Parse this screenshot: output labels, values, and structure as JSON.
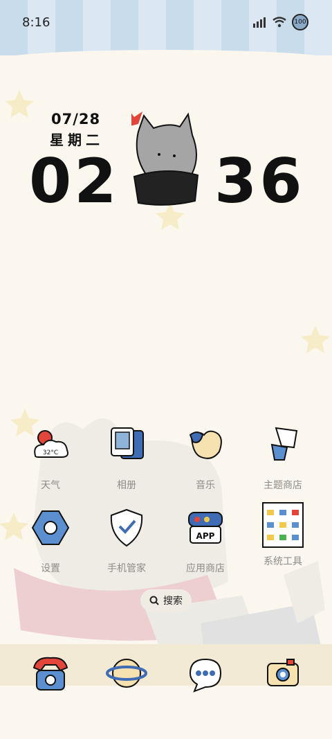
{
  "status_bar": {
    "time": "8:16",
    "battery": "100"
  },
  "clock": {
    "date": "07/28",
    "weekday": "星期二",
    "hour": "02",
    "minute": "36"
  },
  "apps": [
    {
      "label": "天气",
      "icon": "weather-icon",
      "temp": "32°C"
    },
    {
      "label": "相册",
      "icon": "gallery-icon"
    },
    {
      "label": "音乐",
      "icon": "music-icon"
    },
    {
      "label": "主题商店",
      "icon": "theme-store-icon"
    },
    {
      "label": "设置",
      "icon": "settings-icon"
    },
    {
      "label": "手机管家",
      "icon": "phone-manager-icon"
    },
    {
      "label": "应用商店",
      "icon": "app-store-icon",
      "badge": "APP"
    },
    {
      "label": "系统工具",
      "icon": "system-tools-icon"
    }
  ],
  "search": {
    "label": "搜索"
  },
  "dock": [
    {
      "icon": "phone-icon"
    },
    {
      "icon": "browser-icon"
    },
    {
      "icon": "messages-icon"
    },
    {
      "icon": "camera-icon"
    }
  ]
}
